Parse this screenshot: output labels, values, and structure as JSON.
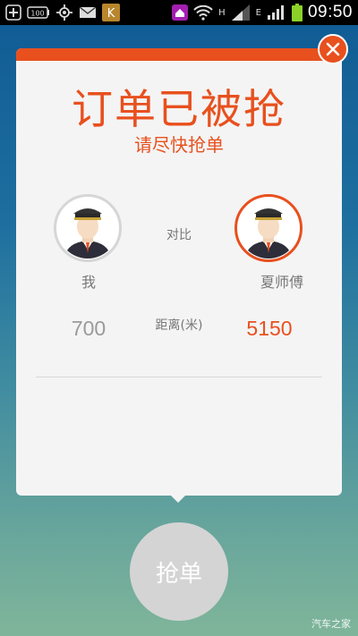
{
  "status_bar": {
    "time": "09:50",
    "battery_label": "100",
    "network_h": "H",
    "network_e": "E",
    "icons": [
      "plus-icon",
      "battery-100-icon",
      "gps-icon",
      "mail-icon",
      "app-k-icon",
      "home-icon",
      "wifi-icon",
      "signal-icon",
      "battery-icon"
    ]
  },
  "dialog": {
    "title": "订单已被抢",
    "subtitle": "请尽快抢单",
    "compare_label": "对比",
    "distance_label": "距离(米)",
    "me": {
      "name": "我",
      "distance": "700"
    },
    "other": {
      "name": "夏师傅",
      "distance": "5150"
    }
  },
  "grab_button": {
    "label": "抢单"
  },
  "watermark": "汽车之家",
  "colors": {
    "accent": "#e8501e",
    "card": "#f4f4f4"
  }
}
